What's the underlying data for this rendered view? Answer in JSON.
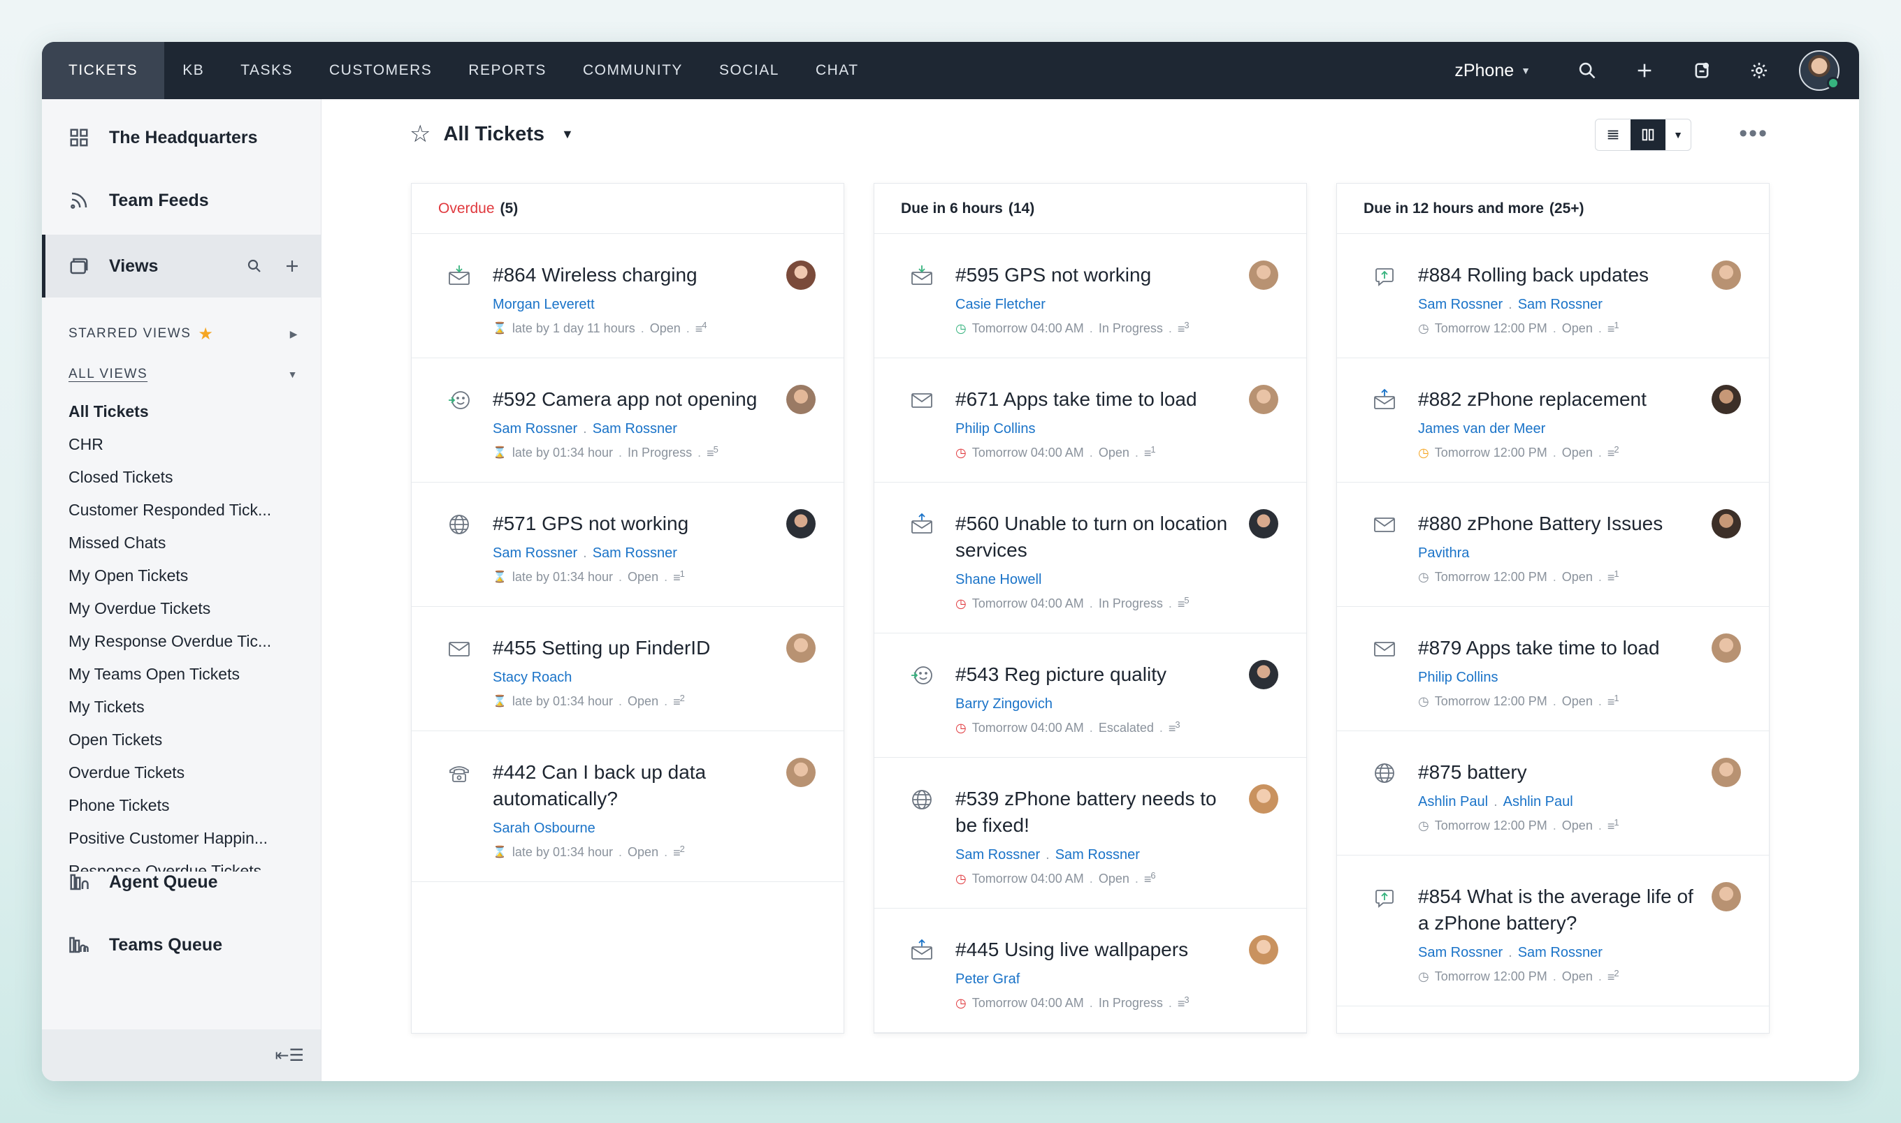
{
  "nav": {
    "items": [
      "TICKETS",
      "KB",
      "TASKS",
      "CUSTOMERS",
      "REPORTS",
      "COMMUNITY",
      "SOCIAL",
      "CHAT"
    ],
    "active": "TICKETS",
    "brand": "zPhone",
    "icons": [
      "search-icon",
      "plus-icon",
      "notification-icon",
      "gear-icon",
      "avatar"
    ]
  },
  "sidebar": {
    "main_items": [
      "The Headquarters",
      "Team Feeds",
      "Views"
    ],
    "starred_views_label": "STARRED VIEWS",
    "all_views_label": "ALL VIEWS",
    "views": [
      "All Tickets",
      "CHR",
      "Closed Tickets",
      "Customer Responded Tick...",
      "Missed Chats",
      "My Open Tickets",
      "My Overdue Tickets",
      "My Response Overdue Tic...",
      "My Teams Open Tickets",
      "My Tickets",
      "Open Tickets",
      "Overdue Tickets",
      "Phone Tickets",
      "Positive Customer Happin...",
      "Response Overdue Tickets"
    ],
    "selected_view": "All Tickets",
    "queue_items": [
      "Agent Queue",
      "Teams Queue"
    ],
    "collapse_icon": "⇤☰"
  },
  "main": {
    "title": "All Tickets",
    "more": "•••"
  },
  "columns": [
    {
      "label": "Overdue",
      "count": "(5)",
      "overdue": true,
      "tickets": [
        {
          "title": "#864 Wireless charging",
          "people": [
            "Morgan Leverett"
          ],
          "meta": "late by 1 day 11 hours",
          "status": "Open",
          "threads": "4",
          "channel": "email-in",
          "avatar": "av-a"
        },
        {
          "title": "#592 Camera app not opening",
          "people": [
            "Sam Rossner",
            "Sam Rossner"
          ],
          "meta": "late by 01:34 hour",
          "status": "In Progress",
          "threads": "5",
          "channel": "feedback",
          "avatar": "av-b"
        },
        {
          "title": "#571 GPS not working",
          "people": [
            "Sam Rossner",
            "Sam Rossner"
          ],
          "meta": "late by 01:34 hour",
          "status": "Open",
          "threads": "1",
          "channel": "web",
          "avatar": "av-c"
        },
        {
          "title": "#455 Setting up FinderID",
          "people": [
            "Stacy Roach"
          ],
          "meta": "late by 01:34 hour",
          "status": "Open",
          "threads": "2",
          "channel": "email",
          "avatar": "av-d"
        },
        {
          "title": "#442 Can I back up data automatically?",
          "people": [
            "Sarah Osbourne"
          ],
          "meta": "late by 01:34 hour",
          "status": "Open",
          "threads": "2",
          "channel": "phone",
          "avatar": "av-d"
        }
      ]
    },
    {
      "label": "Due in 6 hours",
      "count": "(14)",
      "overdue": false,
      "tickets": [
        {
          "title": "#595 GPS not working",
          "people": [
            "Casie Fletcher"
          ],
          "meta": "Tomorrow 04:00 AM",
          "status": "In Progress",
          "threads": "3",
          "channel": "email-in",
          "avatar": "av-d",
          "clock": "g"
        },
        {
          "title": "#671 Apps take time to load",
          "people": [
            "Philip Collins"
          ],
          "meta": "Tomorrow 04:00 AM",
          "status": "Open",
          "threads": "1",
          "channel": "email",
          "avatar": "av-d",
          "clock": "r"
        },
        {
          "title": "#560 Unable to turn on location services",
          "people": [
            "Shane Howell"
          ],
          "meta": "Tomorrow 04:00 AM",
          "status": "In Progress",
          "threads": "5",
          "channel": "email-out",
          "avatar": "av-c",
          "clock": "r"
        },
        {
          "title": "#543 Reg picture quality",
          "people": [
            "Barry Zingovich"
          ],
          "meta": "Tomorrow 04:00 AM",
          "status": "Escalated",
          "threads": "3",
          "channel": "feedback",
          "avatar": "av-c",
          "clock": "r"
        },
        {
          "title": "#539 zPhone battery needs to be fixed!",
          "people": [
            "Sam Rossner",
            "Sam Rossner"
          ],
          "meta": "Tomorrow 04:00 AM",
          "status": "Open",
          "threads": "6",
          "channel": "web",
          "avatar": "av-f",
          "clock": "r"
        },
        {
          "title": "#445 Using live wallpapers",
          "people": [
            "Peter Graf"
          ],
          "meta": "Tomorrow 04:00 AM",
          "status": "In Progress",
          "threads": "3",
          "channel": "email-out",
          "avatar": "av-f",
          "clock": "r"
        }
      ]
    },
    {
      "label": "Due in 12 hours and more",
      "count": "(25+)",
      "overdue": false,
      "tickets": [
        {
          "title": "#884 Rolling back updates",
          "people": [
            "Sam Rossner",
            "Sam Rossner"
          ],
          "meta": "Tomorrow 12:00 PM",
          "status": "Open",
          "threads": "1",
          "channel": "chat",
          "avatar": "av-d",
          "clock": "n"
        },
        {
          "title": "#882 zPhone replacement",
          "people": [
            "James van der Meer"
          ],
          "meta": "Tomorrow 12:00 PM",
          "status": "Open",
          "threads": "2",
          "channel": "email-out",
          "avatar": "av-e",
          "clock": "o"
        },
        {
          "title": "#880 zPhone Battery Issues",
          "people": [
            "Pavithra"
          ],
          "meta": "Tomorrow 12:00 PM",
          "status": "Open",
          "threads": "1",
          "channel": "email",
          "avatar": "av-e",
          "clock": "n"
        },
        {
          "title": "#879 Apps take time to load",
          "people": [
            "Philip Collins"
          ],
          "meta": "Tomorrow 12:00 PM",
          "status": "Open",
          "threads": "1",
          "channel": "email",
          "avatar": "av-d",
          "clock": "n"
        },
        {
          "title": "#875 battery",
          "people": [
            "Ashlin Paul",
            "Ashlin Paul"
          ],
          "meta": "Tomorrow 12:00 PM",
          "status": "Open",
          "threads": "1",
          "channel": "web",
          "avatar": "av-d",
          "clock": "n"
        },
        {
          "title": "#854 What is the average life of a zPhone battery?",
          "people": [
            "Sam Rossner",
            "Sam Rossner"
          ],
          "meta": "Tomorrow 12:00 PM",
          "status": "Open",
          "threads": "2",
          "channel": "chat",
          "avatar": "av-d",
          "clock": "n"
        }
      ]
    }
  ],
  "colors": {
    "accent": "#1a73c8",
    "overdue": "#e0393e",
    "topbar": "#1e2733"
  }
}
